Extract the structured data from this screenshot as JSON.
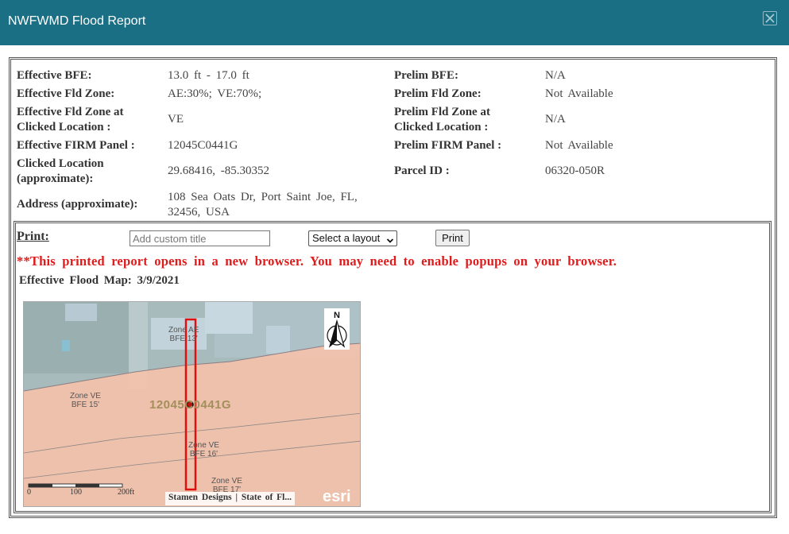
{
  "dialog": {
    "title": "NWFWMD Flood Report",
    "close_icon": "close-icon"
  },
  "info": {
    "rows": [
      {
        "left_label": "Effective BFE:",
        "left_value": "13.0 ft - 17.0 ft",
        "right_label": "Prelim BFE:",
        "right_value": "N/A"
      },
      {
        "left_label": "Effective Fld Zone:",
        "left_value": "AE:30%; VE:70%;",
        "right_label": "Prelim Fld Zone:",
        "right_value": "Not Available"
      },
      {
        "left_label_1": "Effective Fld Zone at",
        "left_label_2": "Clicked Location :",
        "left_value": "VE",
        "right_label_1": "Prelim Fld Zone at",
        "right_label_2": "Clicked Location :",
        "right_value": "N/A"
      },
      {
        "left_label": "Effective FIRM Panel :",
        "left_value": "12045C0441G",
        "right_label": "Prelim FIRM Panel :",
        "right_value": "Not Available"
      },
      {
        "left_label_1": "Clicked Location",
        "left_label_2": "(approximate):",
        "left_value": "29.68416, -85.30352",
        "right_label": "Parcel ID :",
        "right_value": "06320-050R"
      },
      {
        "left_label": "Address (approximate):",
        "left_value_1": "108 Sea Oats Dr, Port Saint Joe, FL,",
        "left_value_2": "32456, USA"
      }
    ]
  },
  "print": {
    "label": "Print:",
    "title_placeholder": "Add custom title",
    "layout_selected": "Select a layout",
    "button_label": "Print",
    "warning": "**This printed report opens in a new browser. You may need to enable popups on your browser.",
    "map_title": "Effective Flood Map: 3/9/2021"
  },
  "map": {
    "zones": [
      {
        "line1": "Zone AE",
        "line2": "BFE 13'"
      },
      {
        "line1": "Zone VE",
        "line2": "BFE 15'"
      },
      {
        "line1": "Zone VE",
        "line2": "BFE 16'"
      },
      {
        "line1": "Zone VE",
        "line2": "BFE 17'"
      }
    ],
    "panel_label": "12045C0441G",
    "north_label": "N",
    "scale": [
      "0",
      "100",
      "200ft"
    ],
    "attribution": "Stamen Designs | State of Fl...",
    "logo": "esri",
    "colors": {
      "zone_ve": "#f3c2ad",
      "zone_ae": "#a9c7d6",
      "parcel_outline": "#e01010"
    }
  }
}
